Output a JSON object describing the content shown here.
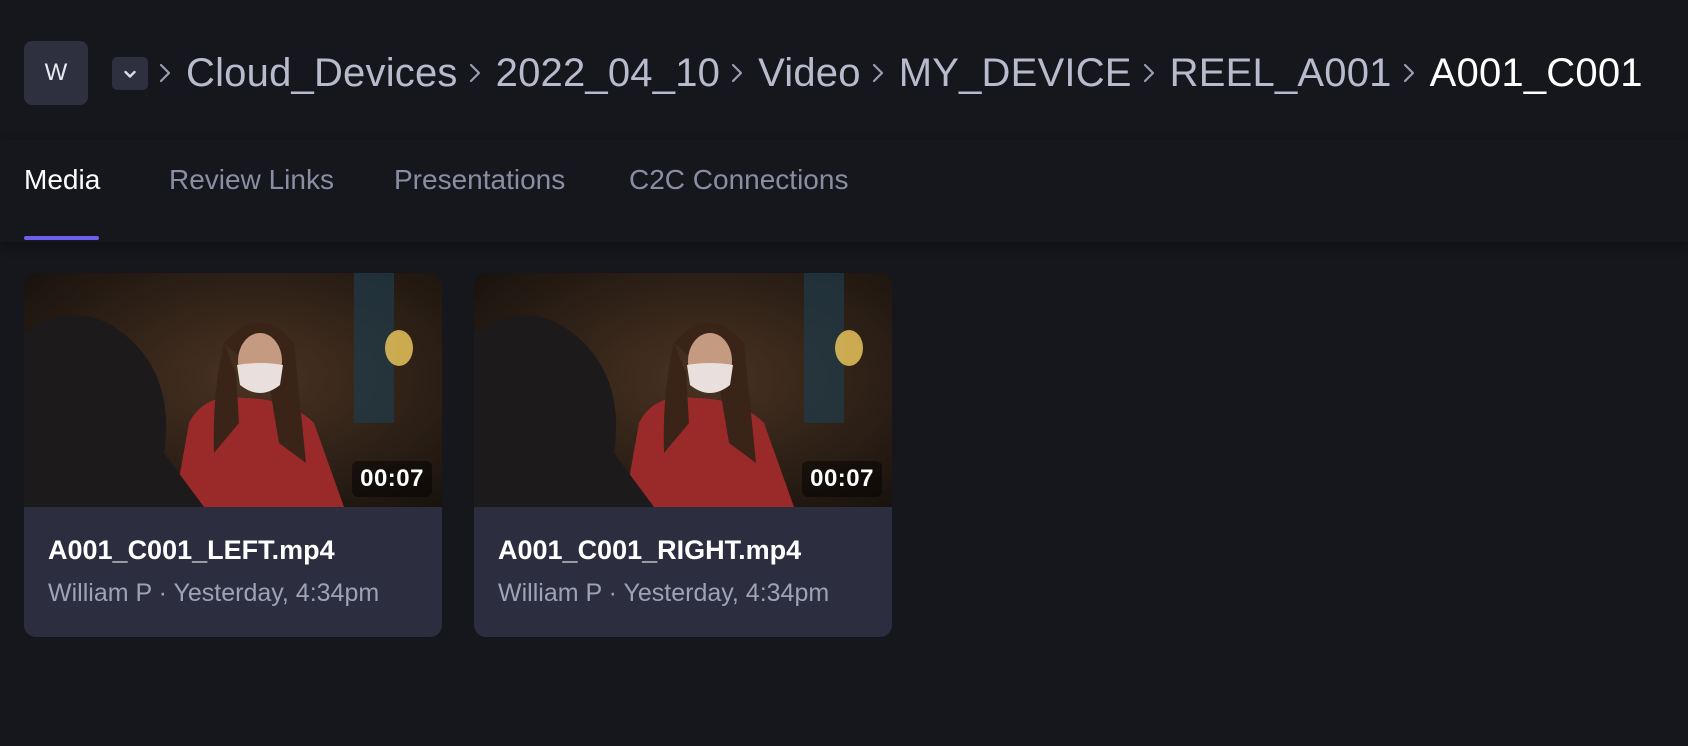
{
  "workspace": {
    "avatar_letter": "W"
  },
  "breadcrumb": {
    "items": [
      "Cloud_Devices",
      "2022_04_10",
      "Video",
      "MY_DEVICE",
      "REEL_A001"
    ],
    "current": "A001_C001"
  },
  "tabs": [
    {
      "label": "Media",
      "active": true
    },
    {
      "label": "Review Links",
      "active": false
    },
    {
      "label": "Presentations",
      "active": false
    },
    {
      "label": "C2C Connections",
      "active": false
    }
  ],
  "media": [
    {
      "name": "A001_C001_LEFT.mp4",
      "uploader": "William P",
      "separator": "·",
      "time": "Yesterday, 4:34pm",
      "duration": "00:07",
      "thumbnail_icon": "video-frame-thumbnail"
    },
    {
      "name": "A001_C001_RIGHT.mp4",
      "uploader": "William P",
      "separator": "·",
      "time": "Yesterday, 4:34pm",
      "duration": "00:07",
      "thumbnail_icon": "video-frame-thumbnail"
    }
  ],
  "colors": {
    "background": "#16161d",
    "card": "#2c2e40",
    "accent": "#6d5fea",
    "muted_text": "#8a8ea3"
  },
  "icons": [
    "chevron-down-icon",
    "chevron-right-icon"
  ]
}
